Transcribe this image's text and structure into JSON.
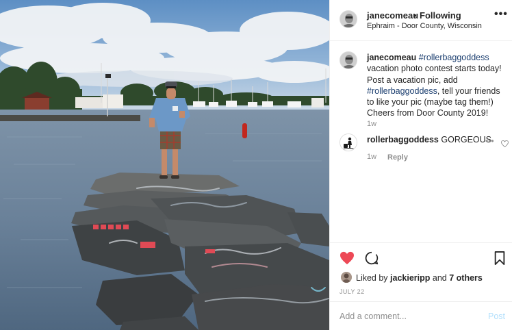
{
  "post": {
    "username": "janecomeau",
    "follow_status": "Following",
    "location": "Ephraim - Door County, Wisconsin",
    "more_icon": "more-horizontal-icon"
  },
  "caption": {
    "username": "janecomeau",
    "hashtag": "#rollerbaggoddess",
    "text_1": "vacation photo contest starts today! Post a vacation pic, add",
    "hashtag_2": "#rollerbaggoddess",
    "text_2": ", tell your friends to like your pic (maybe tag them!) Cheers from Door County 2019!",
    "time": "1w"
  },
  "comments": [
    {
      "username": "rollerbaggoddess",
      "text": "GORGEOUS",
      "time": "1w",
      "reply_label": "Reply"
    }
  ],
  "actions": {
    "like_icon": "heart-filled-icon",
    "comment_icon": "comment-icon",
    "save_icon": "bookmark-icon",
    "like_color": "#ed4956"
  },
  "likes": {
    "prefix": "Liked by",
    "user": "jackieripp",
    "connector": "and",
    "others": "7 others"
  },
  "date": "JULY 22",
  "add_comment": {
    "placeholder": "Add a comment...",
    "post_label": "Post"
  }
}
